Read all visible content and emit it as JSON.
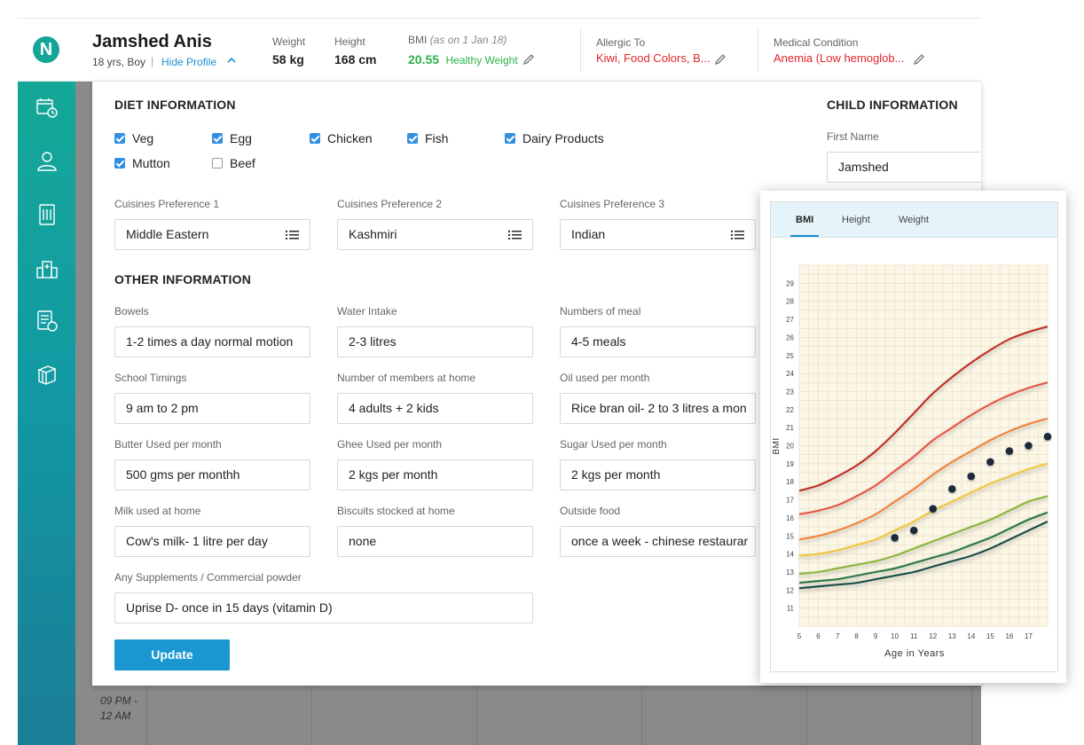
{
  "header": {
    "logo_letter": "N",
    "name": "Jamshed Anis",
    "age_gender": "18 yrs, Boy",
    "separator": "|",
    "hide_profile": "Hide Profile",
    "weight_label": "Weight",
    "weight_value": "58 kg",
    "height_label": "Height",
    "height_value": "168 cm",
    "bmi_label": "BMI",
    "bmi_date": "(as on 1 Jan 18)",
    "bmi_value": "20.55",
    "bmi_status": "Healthy Weight",
    "allergic_label": "Allergic To",
    "allergic_value": "Kiwi, Food Colors, B...",
    "medical_label": "Medical Condition",
    "medical_value": "Anemia (Low hemoglob..."
  },
  "sidebar": {
    "items": [
      {
        "icon": "calendar-clock-icon"
      },
      {
        "icon": "user-icon"
      },
      {
        "icon": "recipe-book-icon"
      },
      {
        "icon": "hospital-icon"
      },
      {
        "icon": "diet-chart-icon"
      },
      {
        "icon": "books-icon"
      }
    ]
  },
  "background": {
    "time_label_line1": "09 PM -",
    "time_label_line2": "12 AM"
  },
  "diet": {
    "title": "DIET INFORMATION",
    "options": [
      {
        "label": "Veg",
        "checked": true
      },
      {
        "label": "Egg",
        "checked": true
      },
      {
        "label": "Chicken",
        "checked": true
      },
      {
        "label": "Fish",
        "checked": true
      },
      {
        "label": "Dairy Products",
        "checked": true
      },
      {
        "label": "Mutton",
        "checked": true
      },
      {
        "label": "Beef",
        "checked": false
      }
    ],
    "cuisines": [
      {
        "label": "Cuisines Preference 1",
        "value": "Middle Eastern"
      },
      {
        "label": "Cuisines Preference 2",
        "value": "Kashmiri"
      },
      {
        "label": "Cuisines Preference 3",
        "value": "Indian"
      }
    ]
  },
  "other": {
    "title": "OTHER INFORMATION",
    "fields": [
      {
        "label": "Bowels",
        "value": "1-2 times a day normal motion"
      },
      {
        "label": "Water Intake",
        "value": "2-3 litres"
      },
      {
        "label": "Numbers of meal",
        "value": "4-5 meals"
      },
      {
        "label": "School Timings",
        "value": "9 am to 2 pm"
      },
      {
        "label": "Number of members at home",
        "value": "4 adults + 2 kids"
      },
      {
        "label": "Oil used per month",
        "value": "Rice bran oil- 2 to 3 litres a mon"
      },
      {
        "label": "Butter Used per month",
        "value": "500 gms per monthh"
      },
      {
        "label": "Ghee Used per month",
        "value": "2 kgs per month"
      },
      {
        "label": "Sugar Used per month",
        "value": "2 kgs per month"
      },
      {
        "label": "Milk used at home",
        "value": "Cow's milk- 1 litre per day"
      },
      {
        "label": "Biscuits stocked at home",
        "value": "none"
      },
      {
        "label": "Outside food",
        "value": "once a week - chinese restaurar"
      }
    ],
    "supplements_label": "Any Supplements / Commercial powder",
    "supplements_value": "Uprise D- once in 15 days (vitamin D)",
    "update_button": "Update"
  },
  "child": {
    "title": "CHILD INFORMATION",
    "first_name_label": "First Name",
    "first_name_value": "Jamshed"
  },
  "chart_tabs": {
    "tab1": "BMI",
    "tab2": "Height",
    "tab3": "Weight",
    "active": "BMI"
  },
  "chart_data": {
    "type": "line",
    "title": "",
    "xlabel": "Age in Years",
    "ylabel": "BMI",
    "xlim": [
      5,
      18
    ],
    "ylim": [
      10,
      30
    ],
    "x_ticks": [
      5,
      6,
      7,
      8,
      9,
      10,
      11,
      12,
      13,
      14,
      15,
      16,
      17
    ],
    "y_ticks": [
      11,
      12,
      13,
      14,
      15,
      16,
      17,
      18,
      19,
      20,
      21,
      22,
      23,
      24,
      25,
      26,
      27,
      28,
      29
    ],
    "grid": true,
    "series": [
      {
        "color": "#c0332a",
        "x": [
          5,
          6,
          7,
          8,
          9,
          10,
          11,
          12,
          13,
          14,
          15,
          16,
          17,
          18
        ],
        "values": [
          17.5,
          17.8,
          18.3,
          18.9,
          19.7,
          20.7,
          21.8,
          22.9,
          23.8,
          24.6,
          25.3,
          25.9,
          26.3,
          26.6
        ]
      },
      {
        "color": "#e4574a",
        "x": [
          5,
          6,
          7,
          8,
          9,
          10,
          11,
          12,
          13,
          14,
          15,
          16,
          17,
          18
        ],
        "values": [
          16.2,
          16.4,
          16.7,
          17.2,
          17.8,
          18.6,
          19.4,
          20.3,
          21.0,
          21.7,
          22.3,
          22.8,
          23.2,
          23.5
        ]
      },
      {
        "color": "#f08542",
        "x": [
          5,
          6,
          7,
          8,
          9,
          10,
          11,
          12,
          13,
          14,
          15,
          16,
          17,
          18
        ],
        "values": [
          14.8,
          15.0,
          15.3,
          15.7,
          16.2,
          16.9,
          17.6,
          18.4,
          19.1,
          19.7,
          20.3,
          20.8,
          21.2,
          21.5
        ]
      },
      {
        "color": "#f0c642",
        "x": [
          5,
          6,
          7,
          8,
          9,
          10,
          11,
          12,
          13,
          14,
          15,
          16,
          17,
          18
        ],
        "values": [
          13.9,
          14.0,
          14.2,
          14.5,
          14.8,
          15.3,
          15.8,
          16.4,
          16.9,
          17.4,
          17.9,
          18.3,
          18.7,
          19.0
        ]
      },
      {
        "color": "#8fb43e",
        "x": [
          5,
          6,
          7,
          8,
          9,
          10,
          11,
          12,
          13,
          14,
          15,
          16,
          17,
          18
        ],
        "values": [
          12.9,
          13.0,
          13.2,
          13.4,
          13.6,
          13.9,
          14.3,
          14.7,
          15.1,
          15.5,
          15.9,
          16.4,
          16.9,
          17.2
        ]
      },
      {
        "color": "#2f7a4a",
        "x": [
          5,
          6,
          7,
          8,
          9,
          10,
          11,
          12,
          13,
          14,
          15,
          16,
          17,
          18
        ],
        "values": [
          12.4,
          12.5,
          12.6,
          12.8,
          13.0,
          13.2,
          13.5,
          13.8,
          14.1,
          14.5,
          14.9,
          15.4,
          15.9,
          16.3
        ]
      },
      {
        "color": "#1f4f4a",
        "x": [
          5,
          6,
          7,
          8,
          9,
          10,
          11,
          12,
          13,
          14,
          15,
          16,
          17,
          18
        ],
        "values": [
          12.1,
          12.2,
          12.3,
          12.4,
          12.6,
          12.8,
          13.0,
          13.3,
          13.6,
          13.9,
          14.3,
          14.8,
          15.3,
          15.8
        ]
      }
    ],
    "points": {
      "color": "#1e2b3a",
      "x": [
        10,
        11,
        12,
        13,
        14,
        15,
        16,
        17,
        18
      ],
      "values": [
        14.9,
        15.3,
        16.5,
        17.6,
        18.3,
        19.1,
        19.7,
        20.0,
        20.5
      ]
    }
  }
}
